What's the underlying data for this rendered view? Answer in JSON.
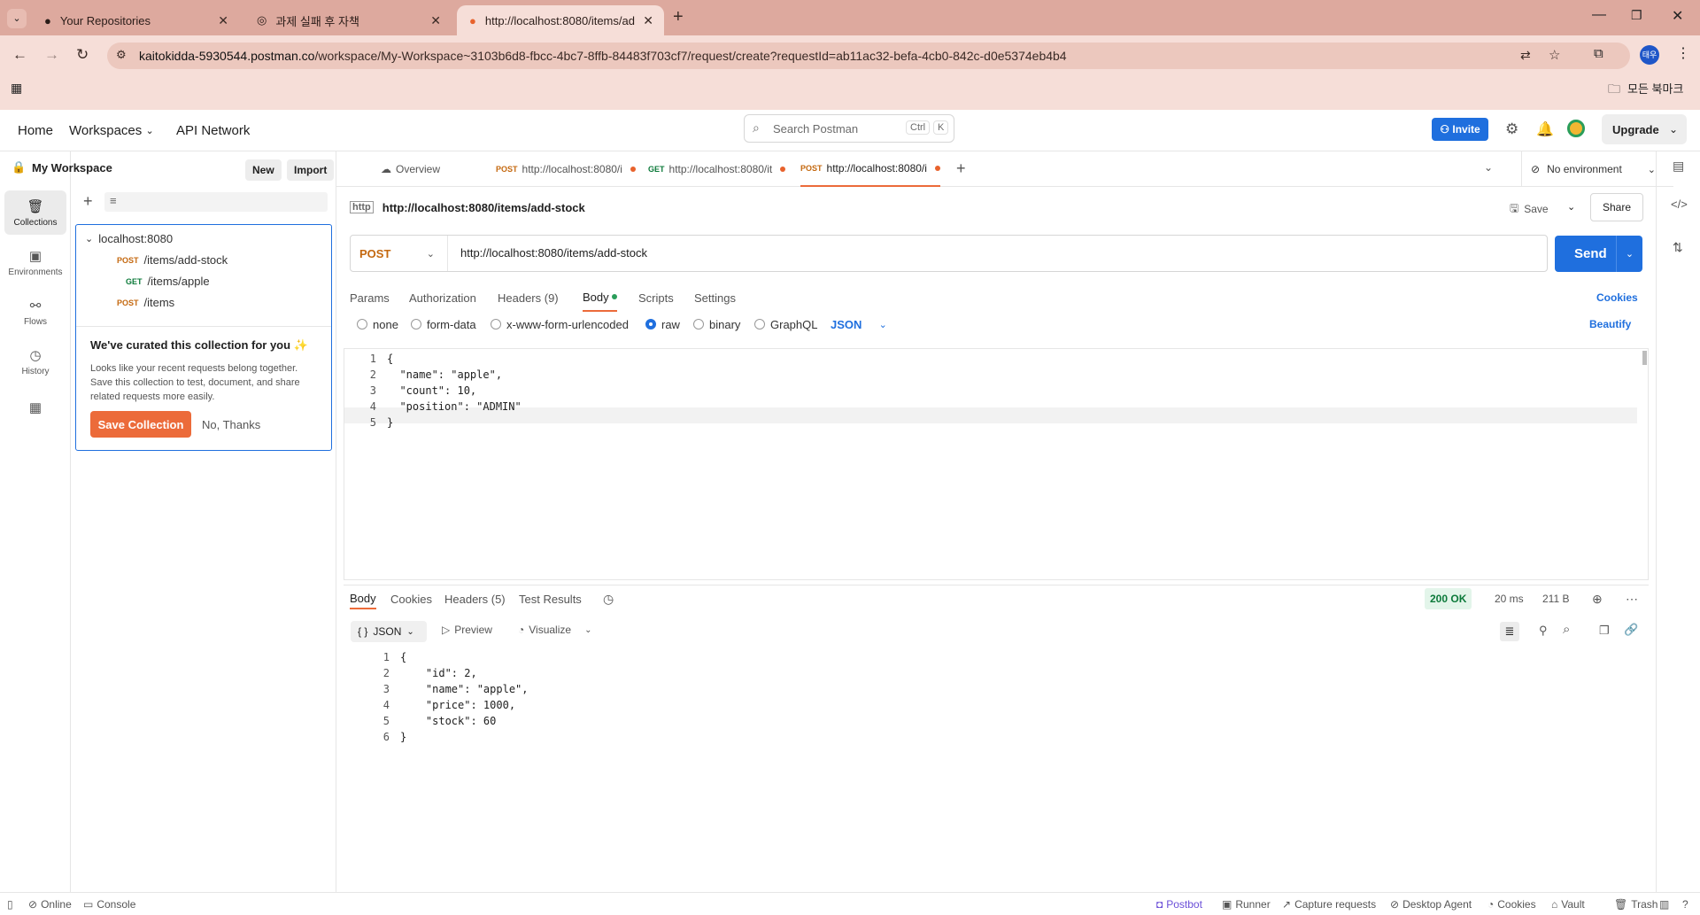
{
  "browser": {
    "tabs": [
      {
        "title": "Your Repositories"
      },
      {
        "title": "과제 실패 후 자책"
      },
      {
        "title": "http://localhost:8080/items/ad"
      }
    ],
    "url_host": "kaitokidda-5930544.postman.co",
    "url_path": "/workspace/My-Workspace~3103b6d8-fbcc-4bc7-8ffb-84483f703cf7/request/create?requestId=ab11ac32-befa-4cb0-842c-d0e5374eb4b4",
    "bookmarks_label": "모든 북마크",
    "profile_initials": "태우"
  },
  "header": {
    "home": "Home",
    "workspaces": "Workspaces",
    "api_network": "API Network",
    "search_placeholder": "Search Postman",
    "kbd_ctrl": "Ctrl",
    "kbd_k": "K",
    "invite": "Invite",
    "upgrade": "Upgrade"
  },
  "leftnav": [
    {
      "label": "Collections"
    },
    {
      "label": "Environments"
    },
    {
      "label": "Flows"
    },
    {
      "label": "History"
    }
  ],
  "sidebar": {
    "workspace": "My Workspace",
    "new": "New",
    "import": "Import",
    "collection": "localhost:8080",
    "requests": [
      {
        "method": "POST",
        "path": "/items/add-stock"
      },
      {
        "method": "GET",
        "path": "/items/apple"
      },
      {
        "method": "POST",
        "path": "/items"
      }
    ],
    "curated_title": "We've curated this collection for you",
    "curated_body": "Looks like your recent requests belong together. Save this collection to test, document, and share related requests more easily.",
    "save_collection": "Save Collection",
    "no_thanks": "No, Thanks"
  },
  "request_tabs": {
    "overview": "Overview",
    "tabs": [
      {
        "method": "POST",
        "label": "http://localhost:8080/i"
      },
      {
        "method": "GET",
        "label": "http://localhost:8080/it"
      },
      {
        "method": "POST",
        "label": "http://localhost:8080/i"
      }
    ],
    "environment": "No environment"
  },
  "request": {
    "name": "http://localhost:8080/items/add-stock",
    "save": "Save",
    "share": "Share",
    "method": "POST",
    "url": "http://localhost:8080/items/add-stock",
    "send": "Send",
    "subtabs": {
      "params": "Params",
      "authorization": "Authorization",
      "headers": "Headers (9)",
      "body": "Body",
      "scripts": "Scripts",
      "settings": "Settings",
      "cookies": "Cookies"
    },
    "body_types": {
      "none": "none",
      "form_data": "form-data",
      "urlencoded": "x-www-form-urlencoded",
      "raw": "raw",
      "binary": "binary",
      "graphql": "GraphQL",
      "json": "JSON",
      "beautify": "Beautify"
    },
    "body_lines": [
      "{",
      "  \"name\": \"apple\",",
      "  \"count\": 10,",
      "  \"position\": \"ADMIN\"",
      "}"
    ]
  },
  "response": {
    "tabs": {
      "body": "Body",
      "cookies": "Cookies",
      "headers": "Headers (5)",
      "tests": "Test Results"
    },
    "status": "200 OK",
    "time": "20 ms",
    "size": "211 B",
    "format": "JSON",
    "preview": "Preview",
    "visualize": "Visualize",
    "body_lines": [
      "{",
      "    \"id\": 2,",
      "    \"name\": \"apple\",",
      "    \"price\": 1000,",
      "    \"stock\": 60",
      "}"
    ]
  },
  "footer": {
    "online": "Online",
    "console": "Console",
    "postbot": "Postbot",
    "runner": "Runner",
    "capture": "Capture requests",
    "agent": "Desktop Agent",
    "cookies": "Cookies",
    "vault": "Vault",
    "trash": "Trash"
  }
}
